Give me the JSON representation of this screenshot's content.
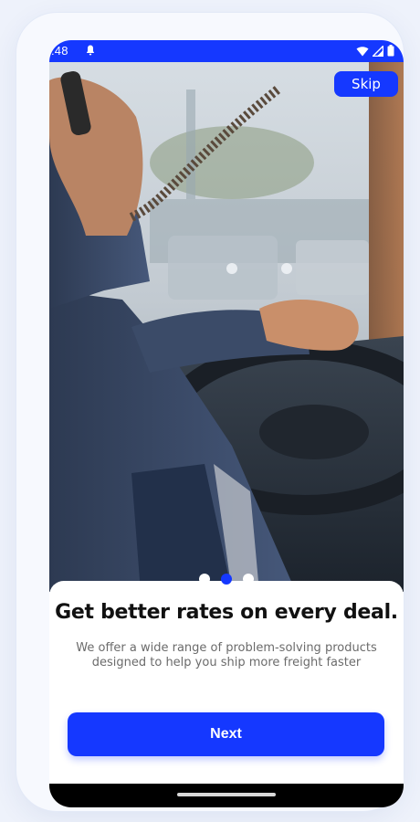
{
  "status_bar": {
    "time": ":48",
    "icons": [
      "bell-icon",
      "wifi-icon",
      "signal-icon",
      "battery-icon"
    ],
    "background": "#1538ff"
  },
  "onboarding": {
    "skip_label": "Skip",
    "hero_image": "truck-driver-photo",
    "page_indicator": {
      "pages": 3,
      "active": 2
    },
    "title": "Get better rates on every deal.",
    "subtitle": "We offer a wide range of problem-solving products designed to help you ship more freight faster",
    "next_label": "Next"
  },
  "colors": {
    "accent": "#1538ff",
    "title_text": "#111111",
    "body_text": "#6b6b6b",
    "page_background": "#eef2fb"
  }
}
